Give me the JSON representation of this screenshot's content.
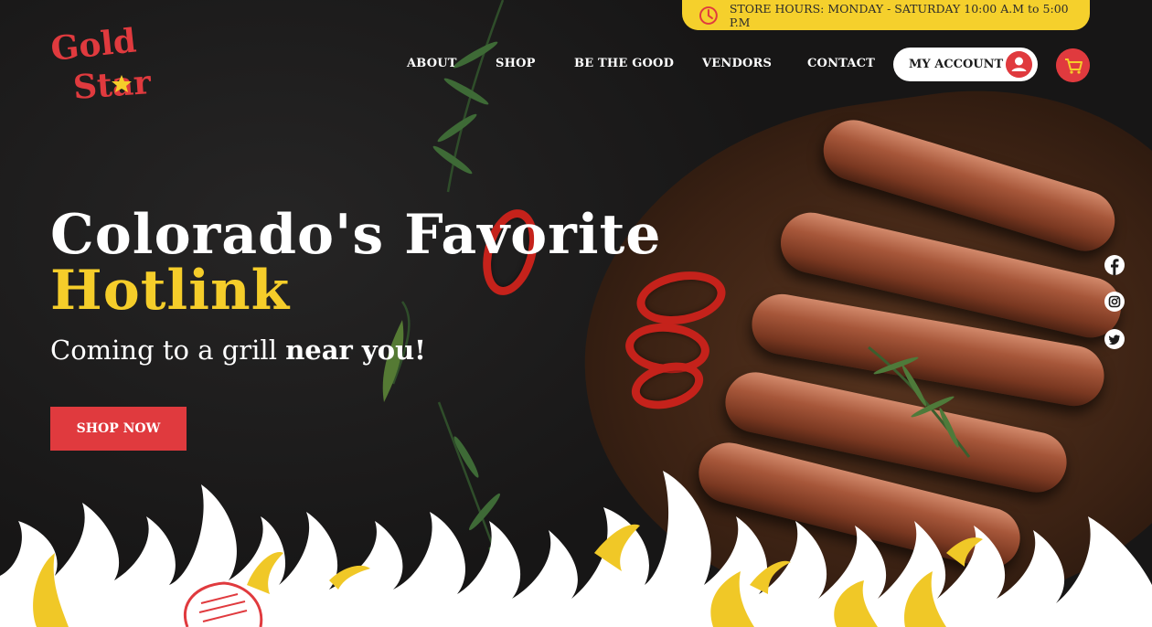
{
  "brand": {
    "logo_text_line1": "Gold",
    "logo_text_line2": "Star",
    "colors": {
      "red": "#e03a3e",
      "yellow": "#f5cd2a",
      "dark": "#1c1b1b",
      "white": "#ffffff"
    }
  },
  "store_hours": {
    "icon": "clock-icon",
    "text": "STORE HOURS: MONDAY - SATURDAY 10:00 A.M to 5:00 P.M"
  },
  "nav": {
    "items": [
      {
        "label": "ABOUT"
      },
      {
        "label": "SHOP"
      },
      {
        "label": "BE THE GOOD"
      },
      {
        "label": "VENDORS"
      },
      {
        "label": "CONTACT"
      }
    ],
    "account_label": "MY ACCOUNT",
    "account_icon": "user-icon",
    "cart_icon": "cart-icon"
  },
  "hero": {
    "title_line1": "Colorado's Favorite",
    "title_line2": "Hotlink",
    "subtitle_prefix": "Coming to a grill ",
    "subtitle_bold": "near you!",
    "cta_label": "SHOP NOW"
  },
  "social": [
    {
      "icon": "facebook-icon"
    },
    {
      "icon": "instagram-icon"
    },
    {
      "icon": "twitter-icon"
    }
  ]
}
